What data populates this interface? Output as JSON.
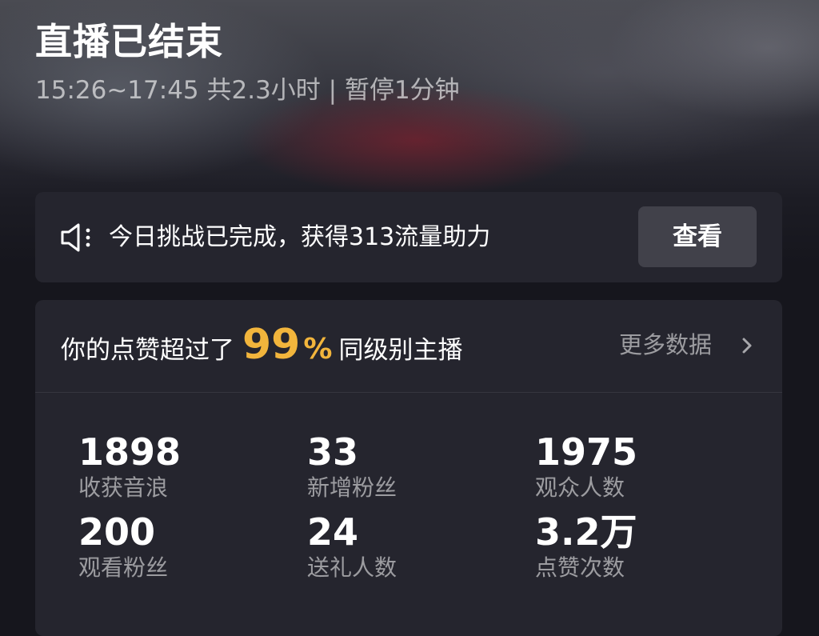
{
  "header": {
    "title": "直播已结束",
    "subtitle": "15:26~17:45 共2.3小时 | 暂停1分钟"
  },
  "notice": {
    "icon": "speaker-icon",
    "text": "今日挑战已完成，获得313流量助力",
    "button_label": "查看"
  },
  "summary": {
    "prefix": "你的点赞超过了",
    "percent": "99",
    "percent_sign": "%",
    "suffix": "同级别主播",
    "more_label": "更多数据",
    "more_icon": "chevron-right-icon",
    "accent_color": "#f2b53c"
  },
  "stats": [
    {
      "value": "1898",
      "label": "收获音浪"
    },
    {
      "value": "33",
      "label": "新增粉丝"
    },
    {
      "value": "1975",
      "label": "观众人数"
    },
    {
      "value": "200",
      "label": "观看粉丝"
    },
    {
      "value": "24",
      "label": "送礼人数"
    },
    {
      "value": "3.2万",
      "label": "点赞次数"
    }
  ]
}
